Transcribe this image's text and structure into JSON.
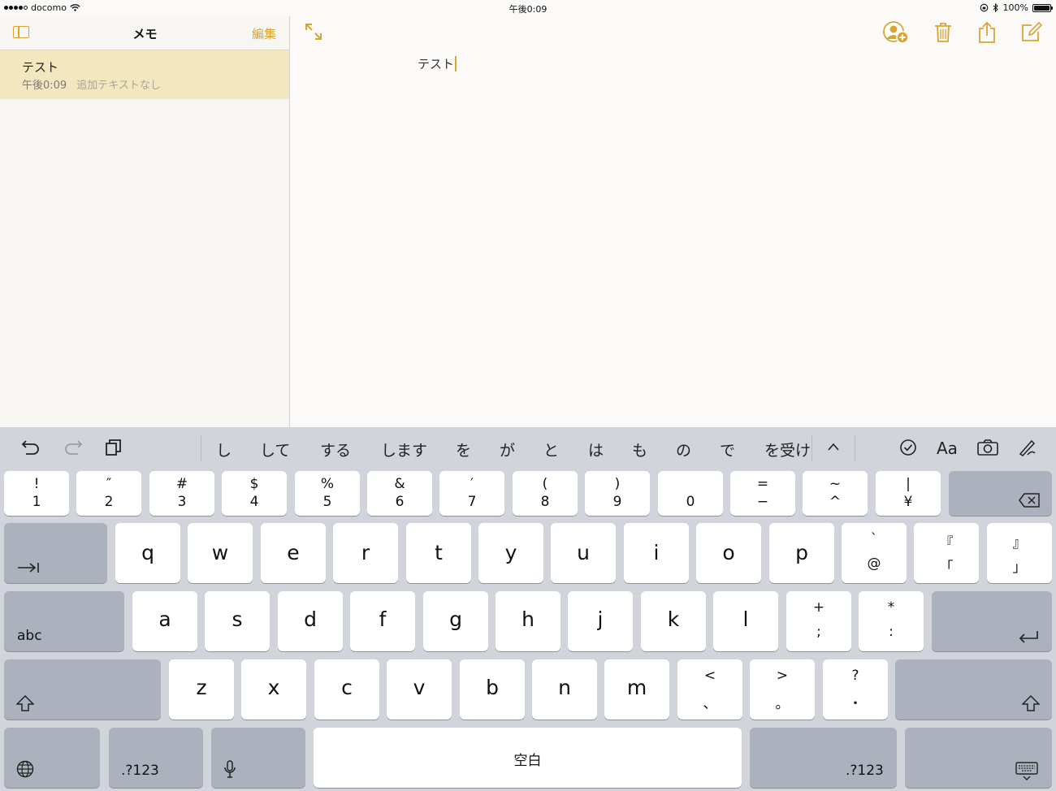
{
  "status_bar": {
    "carrier": "docomo",
    "time": "午後0:09",
    "battery_percent": "100%",
    "signal_bars_filled": 4
  },
  "sidebar": {
    "title": "メモ",
    "edit_label": "編集",
    "notes": [
      {
        "title": "テスト",
        "time": "午後0:09",
        "preview": "追加テキストなし",
        "selected": true
      }
    ]
  },
  "editor": {
    "text": "テスト"
  },
  "keyboard": {
    "predictions": [
      "し",
      "して",
      "する",
      "します",
      "を",
      "が",
      "と",
      "は",
      "も",
      "の",
      "で",
      "を受け"
    ],
    "number_row": [
      {
        "top": "!",
        "bottom": "1"
      },
      {
        "top": "″",
        "bottom": "2"
      },
      {
        "top": "#",
        "bottom": "3"
      },
      {
        "top": "$",
        "bottom": "4"
      },
      {
        "top": "%",
        "bottom": "5"
      },
      {
        "top": "&",
        "bottom": "6"
      },
      {
        "top": "′",
        "bottom": "7"
      },
      {
        "top": "(",
        "bottom": "8"
      },
      {
        "top": ")",
        "bottom": "9"
      },
      {
        "top": "",
        "bottom": "0"
      },
      {
        "top": "=",
        "bottom": "−"
      },
      {
        "top": "~",
        "bottom": "^"
      },
      {
        "top": "|",
        "bottom": "¥"
      }
    ],
    "row_q": [
      "q",
      "w",
      "e",
      "r",
      "t",
      "y",
      "u",
      "i",
      "o",
      "p"
    ],
    "row_q_extra": [
      {
        "top": "`",
        "bottom": "@"
      },
      {
        "top": "『",
        "bottom": "「"
      },
      {
        "top": "』",
        "bottom": "」"
      }
    ],
    "row_a": [
      "a",
      "s",
      "d",
      "f",
      "g",
      "h",
      "j",
      "k",
      "l"
    ],
    "row_a_extra": [
      {
        "top": "+",
        "bottom": ";"
      },
      {
        "top": "*",
        "bottom": ":"
      }
    ],
    "row_z": [
      "z",
      "x",
      "c",
      "v",
      "b",
      "n",
      "m"
    ],
    "row_z_extra": [
      {
        "top": "<",
        "bottom": "、"
      },
      {
        "top": ">",
        "bottom": "。"
      },
      {
        "top": "?",
        "bottom": "・"
      }
    ],
    "abc_label": "abc",
    "numbers_label": ".?123",
    "space_label": "空白",
    "accent_color": "#d8a632"
  }
}
